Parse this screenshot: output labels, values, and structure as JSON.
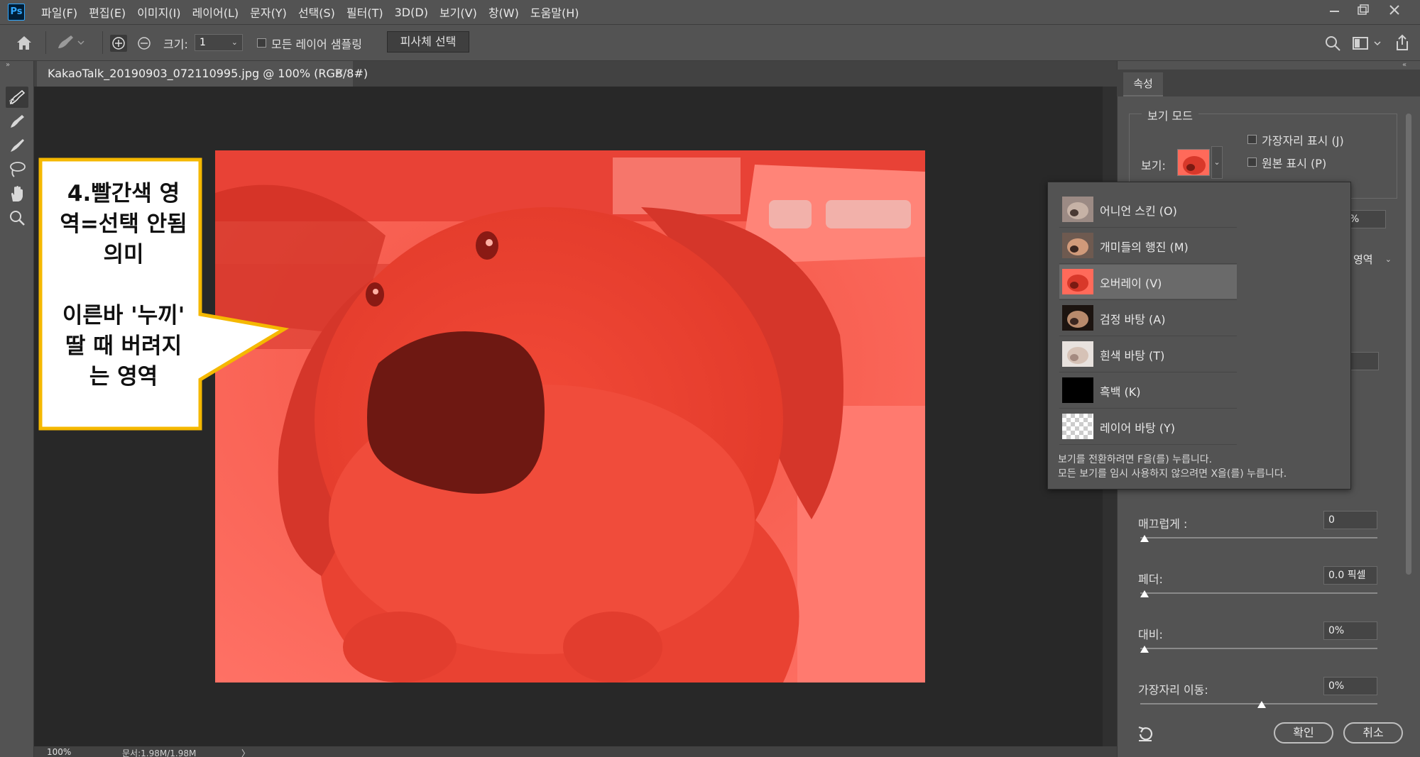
{
  "app": {
    "logo": "Ps"
  },
  "menu": [
    "파일(F)",
    "편집(E)",
    "이미지(I)",
    "레이어(L)",
    "문자(Y)",
    "선택(S)",
    "필터(T)",
    "3D(D)",
    "보기(V)",
    "창(W)",
    "도움말(H)"
  ],
  "options": {
    "size_label": "크기:",
    "size_value": "1",
    "sample_all_layers": "모든 레이어 샘플링",
    "select_subject": "피사체 선택"
  },
  "document": {
    "tab_title": "KakaoTalk_20190903_072110995.jpg @ 100% (RGB/8#)",
    "close": "×"
  },
  "status": {
    "zoom": "100%",
    "doc_size": "문서:1.98M/1.98M",
    "arrow": "〉"
  },
  "callout": {
    "text": "4.빨간색 영\n역=선택 안됨\n의미\n\n이른바 '누끼'\n딸 때 버려지\n는 영역"
  },
  "properties": {
    "tab": "속성",
    "view_mode_title": "보기 모드",
    "view_label": "보기:",
    "show_edge": "가장자리 표시 (J)",
    "show_original": "원본 표시 (P)",
    "partial_percent": "%",
    "partial_area": "영역",
    "smooth_label": "매끄럽게 :",
    "smooth_value": "0",
    "feather_label": "페더:",
    "feather_value": "0.0 픽셀",
    "contrast_label": "대비:",
    "contrast_value": "0%",
    "shift_edge_label": "가장자리 이동:",
    "shift_edge_value": "0%",
    "ok": "확인",
    "cancel": "취소"
  },
  "view_dropdown": {
    "items": [
      {
        "label": "어니언 스킨 (O)",
        "thumb": "onion"
      },
      {
        "label": "개미들의 행진 (M)",
        "thumb": "ants"
      },
      {
        "label": "오버레이 (V)",
        "thumb": "overlay",
        "selected": true
      },
      {
        "label": "검정 바탕 (A)",
        "thumb": "black-bg"
      },
      {
        "label": "흰색 바탕 (T)",
        "thumb": "white-bg"
      },
      {
        "label": "흑백 (K)",
        "thumb": "bw"
      },
      {
        "label": "레이어 바탕 (Y)",
        "thumb": "layer-bg"
      }
    ],
    "hint1": "보기를 전환하려면 F을(를) 누릅니다.",
    "hint2": "모든 보기를 임시 사용하지 않으려면 X을(를) 누릅니다."
  },
  "colors": {
    "accent": "#31a8ff",
    "overlay_red": "#ff6b5b",
    "callout_border": "#f5b800"
  },
  "icons": [
    "home-icon",
    "quick-selection-icon",
    "add-to-selection-icon",
    "subtract-from-selection-icon",
    "refine-brush-icon",
    "brush-icon",
    "lasso-icon",
    "hand-icon",
    "zoom-icon",
    "search-icon",
    "workspace-icon",
    "share-icon",
    "reset-icon"
  ]
}
